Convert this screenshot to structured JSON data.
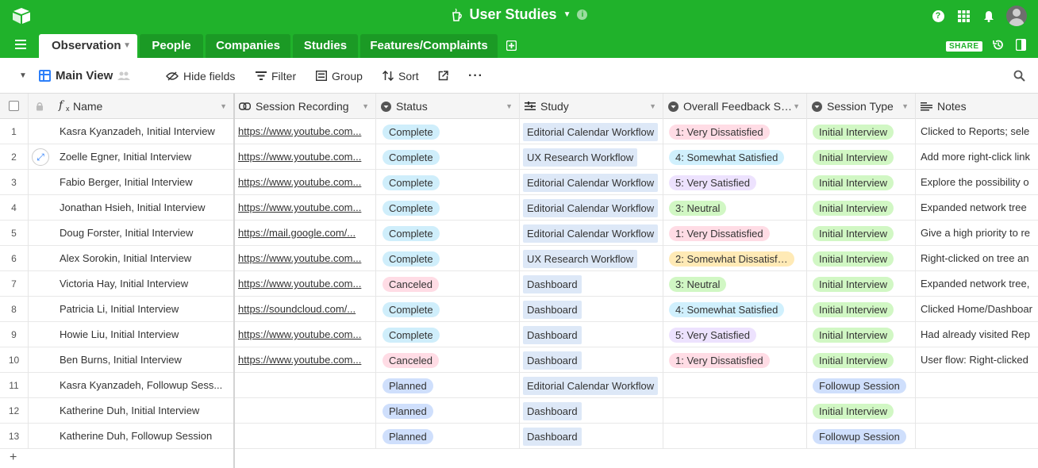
{
  "app": {
    "base_title": "User Studies",
    "share_label": "SHARE"
  },
  "tabs": [
    {
      "label": "Observation",
      "active": true
    },
    {
      "label": "People"
    },
    {
      "label": "Companies"
    },
    {
      "label": "Studies"
    },
    {
      "label": "Features/Complaints"
    }
  ],
  "toolbar": {
    "view_name": "Main View",
    "hide_fields": "Hide fields",
    "filter": "Filter",
    "group": "Group",
    "sort": "Sort"
  },
  "columns": {
    "name": "Name",
    "session_recording": "Session Recording",
    "status": "Status",
    "study": "Study",
    "feedback": "Overall Feedback S…",
    "session_type": "Session Type",
    "notes": "Notes"
  },
  "colors": {
    "brand": "#20b22b",
    "status": {
      "Complete": "#cfeefb",
      "Canceled": "#ffdce5",
      "Planned": "#cfdffc"
    },
    "feedback": {
      "1: Very Dissatisfied": "#ffdce5",
      "2: Somewhat Dissatisf…": "#ffeab6",
      "3: Neutral": "#d1f7c4",
      "4: Somewhat Satisfied": "#d0f0fd",
      "5: Very Satisfied": "#ede2fe"
    },
    "session_type": {
      "Initial Interview": "#d1f7c4",
      "Followup Session": "#cfdffc"
    }
  },
  "rows": [
    {
      "num": "1",
      "name": "Kasra Kyanzadeh, Initial Interview",
      "recording": "https://www.youtube.com...",
      "status": "Complete",
      "study": "Editorial Calendar Workflow",
      "feedback": "1: Very Dissatisfied",
      "session_type": "Initial Interview",
      "notes": "Clicked to Reports; sele"
    },
    {
      "num": "2",
      "name": "Zoelle Egner, Initial Interview",
      "recording": "https://www.youtube.com...",
      "status": "Complete",
      "study": "UX Research Workflow",
      "feedback": "4: Somewhat Satisfied",
      "session_type": "Initial Interview",
      "notes": "Add more right-click link"
    },
    {
      "num": "3",
      "name": "Fabio Berger, Initial Interview",
      "recording": "https://www.youtube.com...",
      "status": "Complete",
      "study": "Editorial Calendar Workflow",
      "feedback": "5: Very Satisfied",
      "session_type": "Initial Interview",
      "notes": "Explore the possibility o"
    },
    {
      "num": "4",
      "name": "Jonathan Hsieh, Initial Interview",
      "recording": "https://www.youtube.com...",
      "status": "Complete",
      "study": "Editorial Calendar Workflow",
      "feedback": "3: Neutral",
      "session_type": "Initial Interview",
      "notes": "Expanded network tree"
    },
    {
      "num": "5",
      "name": "Doug Forster, Initial Interview",
      "recording": "https://mail.google.com/...",
      "status": "Complete",
      "study": "Editorial Calendar Workflow",
      "feedback": "1: Very Dissatisfied",
      "session_type": "Initial Interview",
      "notes": "Give a high priority to re"
    },
    {
      "num": "6",
      "name": "Alex Sorokin, Initial Interview",
      "recording": "https://www.youtube.com...",
      "status": "Complete",
      "study": "UX Research Workflow",
      "feedback": "2: Somewhat Dissatisf…",
      "session_type": "Initial Interview",
      "notes": "Right-clicked on tree an"
    },
    {
      "num": "7",
      "name": "Victoria Hay, Initial Interview",
      "recording": "https://www.youtube.com...",
      "status": "Canceled",
      "study": "Dashboard",
      "feedback": "3: Neutral",
      "session_type": "Initial Interview",
      "notes": "Expanded network tree,"
    },
    {
      "num": "8",
      "name": "Patricia Li, Initial Interview",
      "recording": "https://soundcloud.com/...",
      "status": "Complete",
      "study": "Dashboard",
      "feedback": "4: Somewhat Satisfied",
      "session_type": "Initial Interview",
      "notes": "Clicked Home/Dashboar"
    },
    {
      "num": "9",
      "name": "Howie Liu, Initial Interview",
      "recording": "https://www.youtube.com...",
      "status": "Complete",
      "study": "Dashboard",
      "feedback": "5: Very Satisfied",
      "session_type": "Initial Interview",
      "notes": "Had already visited Rep"
    },
    {
      "num": "10",
      "name": "Ben Burns, Initial Interview",
      "recording": "https://www.youtube.com...",
      "status": "Canceled",
      "study": "Dashboard",
      "feedback": "1: Very Dissatisfied",
      "session_type": "Initial Interview",
      "notes": "User flow: Right-clicked"
    },
    {
      "num": "11",
      "name": "Kasra Kyanzadeh, Followup Sess...",
      "recording": "",
      "status": "Planned",
      "study": "Editorial Calendar Workflow",
      "feedback": "",
      "session_type": "Followup Session",
      "notes": ""
    },
    {
      "num": "12",
      "name": "Katherine Duh, Initial Interview",
      "recording": "",
      "status": "Planned",
      "study": "Dashboard",
      "feedback": "",
      "session_type": "Initial Interview",
      "notes": ""
    },
    {
      "num": "13",
      "name": "Katherine Duh, Followup Session",
      "recording": "",
      "status": "Planned",
      "study": "Dashboard",
      "feedback": "",
      "session_type": "Followup Session",
      "notes": ""
    }
  ]
}
